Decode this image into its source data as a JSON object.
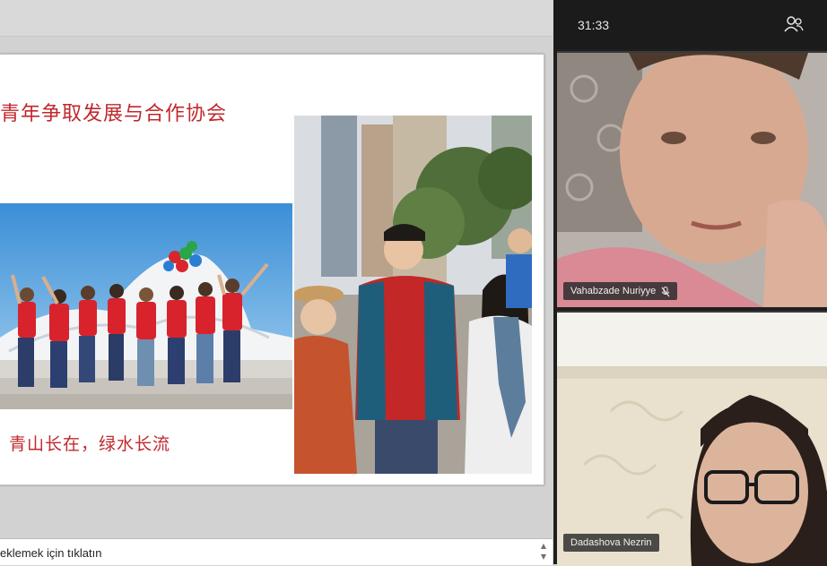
{
  "slide": {
    "title": "青年争取发展与合作协会",
    "subtitle": "青山长在，绿水长流"
  },
  "notes": {
    "text": "eklemek için tıklatın"
  },
  "call": {
    "timer": "31:33",
    "participants": [
      {
        "name": "Vahabzade Nuriyye",
        "muted": true
      },
      {
        "name": "Dadashova Nezrin",
        "muted": false
      }
    ]
  },
  "colors": {
    "slide_title": "#c0282d",
    "call_background": "#1f1f1f"
  },
  "icons": [
    "people-icon",
    "mic-off-icon",
    "scroll-up-icon",
    "scroll-down-icon"
  ]
}
